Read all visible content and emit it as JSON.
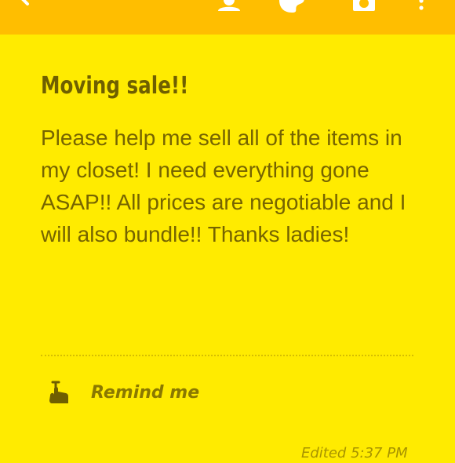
{
  "toolbar": {
    "icons": [
      "back-arrow-icon",
      "person-icon",
      "palette-icon",
      "camera-icon",
      "overflow-menu-icon"
    ]
  },
  "note": {
    "title": "Moving sale!!",
    "body": "Please help me sell all of the items in my closet! I need everything gone ASAP!! All prices are negotiable and I will also bundle!! Thanks ladies!"
  },
  "reminder": {
    "label": "Remind me",
    "icon": "pointing-hand-icon"
  },
  "footer": {
    "edited": "Edited 5:37 PM"
  },
  "colors": {
    "toolbar": "#FFBE00",
    "note_background": "#FFEB00",
    "title_text": "#6F5F00",
    "body_text": "#766400"
  }
}
